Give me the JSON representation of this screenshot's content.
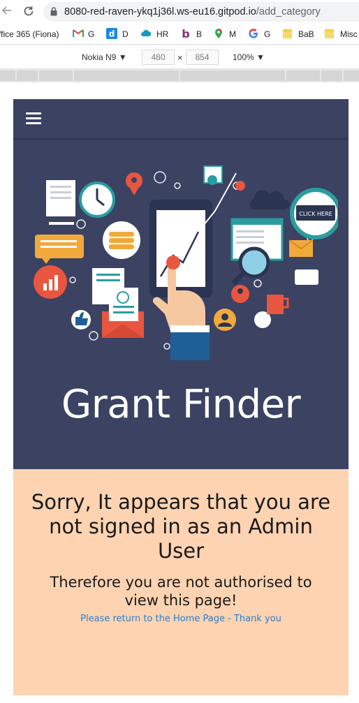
{
  "browser": {
    "url_host": "8080-red-raven-ykq1j36l.ws-eu16.gitpod.io",
    "url_path": "/add_category",
    "bookmarks": [
      {
        "label": "ffice 365 (Fiona)",
        "icon": "office-icon"
      },
      {
        "label": "G",
        "icon": "gmail-icon"
      },
      {
        "label": "D",
        "icon": "d-icon"
      },
      {
        "label": "HR",
        "icon": "cloud-icon"
      },
      {
        "label": "B",
        "icon": "b-icon"
      },
      {
        "label": "M",
        "icon": "maps-icon"
      },
      {
        "label": "G",
        "icon": "google-icon"
      },
      {
        "label": "BaB",
        "icon": "folder-icon"
      },
      {
        "label": "Misc",
        "icon": "folder-icon"
      }
    ]
  },
  "devtools": {
    "device": "Nokia N9",
    "width": "480",
    "times": "×",
    "height": "854",
    "zoom": "100%"
  },
  "page": {
    "title": "Grant Finder",
    "heading": "Sorry, It appears that you are not signed in as an Admin User",
    "subheading": "Therefore you are not authorised to view this page!",
    "link_text": "Please return to the Home Page - Thank you",
    "illustration_button": "CLICK HERE",
    "colors": {
      "hero": "#3b4262",
      "body": "#fed3b1",
      "link": "#2b7fc9"
    }
  }
}
